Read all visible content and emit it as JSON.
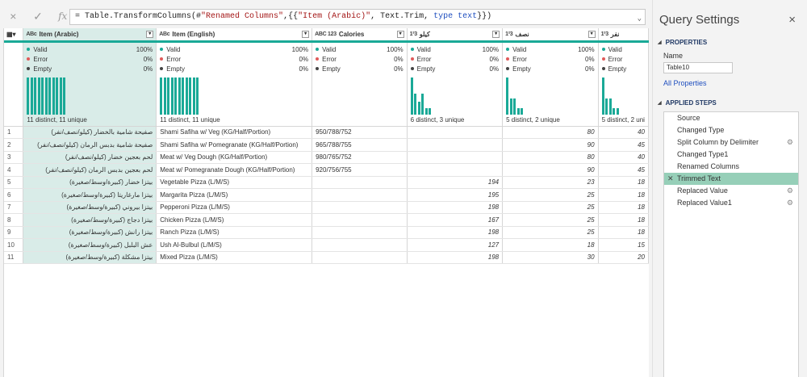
{
  "formula": {
    "cancel_icon": "×",
    "commit_icon": "✓",
    "fx_label": "fx",
    "prefix": "= Table.TransformColumns(#",
    "step_ref": "\"Renamed Columns\"",
    "mid": ",{{",
    "col": "\"Item (Arabic)\"",
    "fn": ", Text.Trim, ",
    "kw": "type text",
    "suffix": "}})"
  },
  "grid": {
    "columns": [
      {
        "type": "ABc",
        "name": "Item (Arabic)",
        "valid": "100%",
        "error": "0%",
        "empty": "0%",
        "distinct": "11 distinct, 11 unique"
      },
      {
        "type": "ABc",
        "name": "Item (English)",
        "valid": "100%",
        "error": "0%",
        "empty": "0%",
        "distinct": "11 distinct, 11 unique"
      },
      {
        "type": "ABC 123",
        "name": "Calories",
        "valid": "100%",
        "error": "0%",
        "empty": "0%",
        "distinct": ""
      },
      {
        "type": "1²3",
        "name": "كيلو",
        "valid": "100%",
        "error": "0%",
        "empty": "0%",
        "distinct": "6 distinct, 3 unique"
      },
      {
        "type": "1²3",
        "name": "نصف",
        "valid": "100%",
        "error": "0%",
        "empty": "0%",
        "distinct": "5 distinct, 2 unique"
      },
      {
        "type": "1²3",
        "name": "نفر",
        "valid": "Valid",
        "error": "Error",
        "empty": "Empty",
        "distinct": "5 distinct, 2 uni"
      }
    ],
    "quality_labels": {
      "valid": "Valid",
      "error": "Error",
      "empty": "Empty"
    },
    "rows": [
      [
        "1",
        "صفيحة شامية بالخضار (كيلو/نصف/نفر)",
        "Shami Safiha w/ Veg (KG/Half/Portion)",
        "950/788/752",
        "",
        "80",
        "40"
      ],
      [
        "2",
        "صفيحة شامية بدبس الرمان (كيلو/نصف/نفر)",
        "Shami Safiha w/ Pomegranate (KG/Half/Portion)",
        "965/788/755",
        "",
        "90",
        "45"
      ],
      [
        "3",
        "لحم بعجين خضار (كيلو/نصف/نفر)",
        "Meat w/ Veg Dough (KG/Half/Portion)",
        "980/765/752",
        "",
        "80",
        "40"
      ],
      [
        "4",
        "لحم بعجين بدبس الرمان (كيلو/نصف/نفر)",
        "Meat w/ Pomegranate Dough (KG/Half/Portion)",
        "920/756/755",
        "",
        "90",
        "45"
      ],
      [
        "5",
        "بيتزا خضار (كبيرة/وسط/صغيرة)",
        "Vegetable Pizza (L/M/S)",
        "",
        "194",
        "23",
        "18"
      ],
      [
        "6",
        "بيتزا مارغاريتا (كبيرة/وسط/صغيرة)",
        "Margarita Pizza (L/M/S)",
        "",
        "195",
        "25",
        "18"
      ],
      [
        "7",
        "بيتزا بيروني (كبيرة/وسط/صغيرة)",
        "Pepperoni Pizza (L/M/S)",
        "",
        "198",
        "25",
        "18"
      ],
      [
        "8",
        "بيتزا دجاج (كبيرة/وسط/صغيرة)",
        "Chicken Pizza (L/M/S)",
        "",
        "167",
        "25",
        "18"
      ],
      [
        "9",
        "بيتزا رانش (كبيرة/وسط/صغيرة)",
        "Ranch Pizza (L/M/S)",
        "",
        "198",
        "25",
        "18"
      ],
      [
        "10",
        "عش البلبل (كبيرة/وسط/صغيرة)",
        "Ush Al-Bulbul (L/M/S)",
        "",
        "127",
        "18",
        "15"
      ],
      [
        "11",
        "بيتزا مشكلة (كبيرة/وسط/صغيرة)",
        "Mixed Pizza (L/M/S)",
        "",
        "198",
        "30",
        "20"
      ]
    ]
  },
  "query_settings": {
    "title": "Query Settings",
    "close_icon": "×",
    "properties_heading": "PROPERTIES",
    "name_label": "Name",
    "name_value": "Table10",
    "all_properties": "All Properties",
    "applied_steps_heading": "APPLIED STEPS",
    "steps": [
      {
        "label": "Source",
        "gear": false,
        "active": false
      },
      {
        "label": "Changed Type",
        "gear": false,
        "active": false
      },
      {
        "label": "Split Column by Delimiter",
        "gear": true,
        "active": false
      },
      {
        "label": "Changed Type1",
        "gear": false,
        "active": false
      },
      {
        "label": "Renamed Columns",
        "gear": false,
        "active": false
      },
      {
        "label": "Trimmed Text",
        "gear": false,
        "active": true
      },
      {
        "label": "Replaced Value",
        "gear": true,
        "active": false
      },
      {
        "label": "Replaced Value1",
        "gear": true,
        "active": false
      }
    ]
  },
  "colors": {
    "accent": "#1aa997",
    "selected_column": "#d9ece8",
    "active_step": "#96cfb8",
    "link": "#1f4fbf"
  }
}
